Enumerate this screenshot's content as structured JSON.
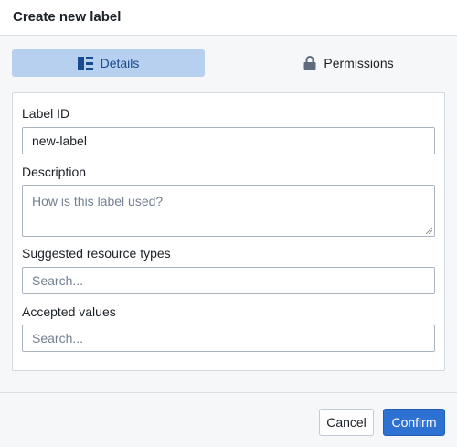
{
  "dialog": {
    "title": "Create new label"
  },
  "tabs": [
    {
      "label": "Details",
      "icon": "list-detail-icon",
      "selected": true
    },
    {
      "label": "Permissions",
      "icon": "lock-icon",
      "selected": false
    }
  ],
  "form": {
    "label_id": {
      "label": "Label ID",
      "value": "new-label"
    },
    "description": {
      "label": "Description",
      "placeholder": "How is this label used?"
    },
    "suggested_resource_types": {
      "label": "Suggested resource types",
      "placeholder": "Search..."
    },
    "accepted_values": {
      "label": "Accepted values",
      "placeholder": "Search..."
    }
  },
  "footer": {
    "cancel_label": "Cancel",
    "confirm_label": "Confirm"
  },
  "colors": {
    "accent": "#2d72d2",
    "selected_tab_bg": "#b8d0ef",
    "selected_tab_text": "#184a90"
  }
}
